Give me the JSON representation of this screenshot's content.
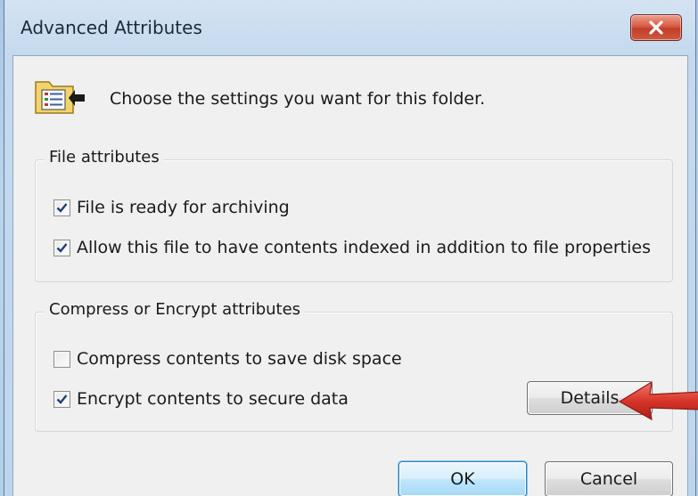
{
  "window": {
    "title": "Advanced Attributes",
    "close_icon": "close-icon"
  },
  "header": {
    "icon": "folder-properties-icon",
    "text": "Choose the settings you want for this folder."
  },
  "file_attributes": {
    "label": "File attributes",
    "options": [
      {
        "label": "File is ready for archiving",
        "checked": true
      },
      {
        "label": "Allow this file to have contents indexed in addition to file properties",
        "checked": true
      }
    ]
  },
  "compress_encrypt": {
    "label": "Compress or Encrypt attributes",
    "options": [
      {
        "label": "Compress contents to save disk space",
        "checked": false
      },
      {
        "label": "Encrypt contents to secure data",
        "checked": true
      }
    ],
    "details_button": "Details"
  },
  "footer": {
    "ok_label": "OK",
    "cancel_label": "Cancel"
  },
  "annotation": {
    "icon": "red-arrow-icon",
    "color": "#d9352a"
  },
  "colors": {
    "close_button": "#c13d28",
    "checkmark": "#1f3f78",
    "ok_focus": "#3c7fb1"
  }
}
